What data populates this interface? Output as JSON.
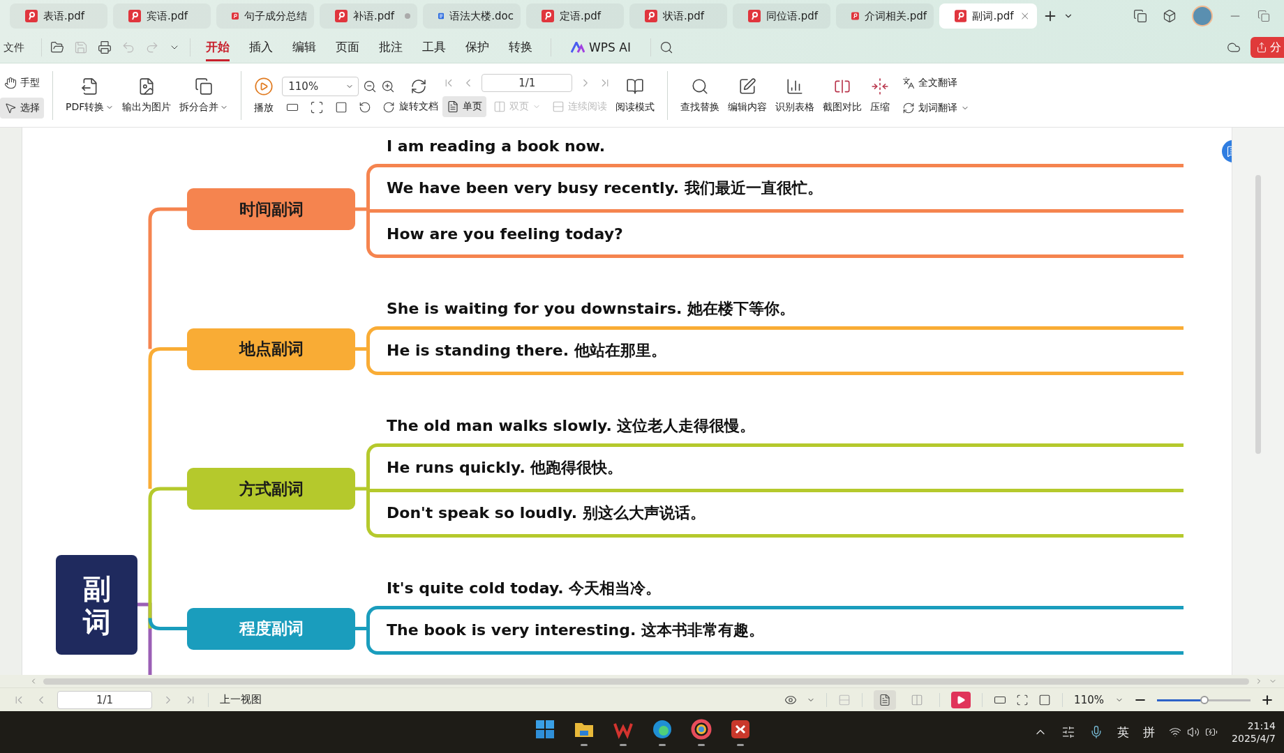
{
  "tabs": [
    {
      "label": "表语.pdf",
      "kind": "pdf",
      "selected": false,
      "modified": false
    },
    {
      "label": "宾语.pdf",
      "kind": "pdf",
      "selected": false,
      "modified": false
    },
    {
      "label": "句子成分总结",
      "kind": "pdf",
      "selected": false,
      "modified": false
    },
    {
      "label": "补语.pdf",
      "kind": "pdf",
      "selected": false,
      "modified": true
    },
    {
      "label": "语法大楼.doc",
      "kind": "word",
      "selected": false,
      "modified": false
    },
    {
      "label": "定语.pdf",
      "kind": "pdf",
      "selected": false,
      "modified": false
    },
    {
      "label": "状语.pdf",
      "kind": "pdf",
      "selected": false,
      "modified": false
    },
    {
      "label": "同位语.pdf",
      "kind": "pdf",
      "selected": false,
      "modified": false
    },
    {
      "label": "介词相关.pdf",
      "kind": "pdf",
      "selected": false,
      "modified": false
    },
    {
      "label": "副词.pdf",
      "kind": "pdf",
      "selected": true,
      "modified": false
    }
  ],
  "menu": {
    "file": "文件",
    "tabs": [
      {
        "label": "开始",
        "selected": true
      },
      {
        "label": "插入",
        "selected": false
      },
      {
        "label": "编辑",
        "selected": false
      },
      {
        "label": "页面",
        "selected": false
      },
      {
        "label": "批注",
        "selected": false
      },
      {
        "label": "工具",
        "selected": false
      },
      {
        "label": "保护",
        "selected": false
      },
      {
        "label": "转换",
        "selected": false
      }
    ],
    "ai": "WPS AI",
    "share": "分"
  },
  "toolbar": {
    "pointer_tools": [
      {
        "label": "手型",
        "kind": "hand",
        "selected": false
      },
      {
        "label": "选择",
        "kind": "select",
        "selected": true
      }
    ],
    "convert_tools": [
      {
        "label": "PDF转换",
        "kind": "convert",
        "dropdown": true
      },
      {
        "label": "输出为图片",
        "kind": "image",
        "dropdown": false
      },
      {
        "label": "拆分合并",
        "kind": "split",
        "dropdown": true
      }
    ],
    "play": "播放",
    "zoom": "110%",
    "rotate": "旋转文档",
    "page": "1/1",
    "view_modes": [
      {
        "label": "单页",
        "kind": "single",
        "selected": true,
        "disabled": false,
        "dropdown": false
      },
      {
        "label": "双页",
        "kind": "double",
        "selected": false,
        "disabled": true,
        "dropdown": true
      },
      {
        "label": "连续阅读",
        "kind": "continuous",
        "selected": false,
        "disabled": true,
        "dropdown": false
      }
    ],
    "read_mode": "阅读模式",
    "tools": [
      {
        "label": "查找替换",
        "kind": "find"
      },
      {
        "label": "编辑内容",
        "kind": "edit"
      },
      {
        "label": "识别表格",
        "kind": "table"
      },
      {
        "label": "截图对比",
        "kind": "compare"
      },
      {
        "label": "压缩",
        "kind": "compress"
      }
    ],
    "translate": [
      {
        "label": "全文翻译",
        "kind": "full",
        "dropdown": false
      },
      {
        "label": "划词翻译",
        "kind": "word",
        "dropdown": true
      }
    ]
  },
  "mindmap": {
    "root": "副词",
    "branches": [
      {
        "label": "时间副词",
        "color": "#f5844f",
        "sentences": [
          "I am reading a book now.",
          "We have been very busy recently. 我们最近一直很忙。",
          "How are you feeling today?"
        ]
      },
      {
        "label": "地点副词",
        "color": "#f9ac35",
        "sentences": [
          "She is waiting for you downstairs. 她在楼下等你。",
          "He is standing there. 他站在那里。"
        ]
      },
      {
        "label": "方式副词",
        "color": "#b5c92c",
        "sentences": [
          "The old man walks slowly. 这位老人走得很慢。",
          "He runs quickly. 他跑得很快。",
          "Don't speak so loudly. 别这么大声说话。"
        ]
      },
      {
        "label": "程度副词",
        "color": "#1a9dbd",
        "sentences": [
          "It's quite cold today. 今天相当冷。",
          "The book is very interesting. 这本书非常有趣。"
        ]
      }
    ]
  },
  "status_bar": {
    "page": "1/1",
    "back_view": "上一视图",
    "zoom": "110%",
    "zoom_slider": {
      "level": 0.51
    },
    "views": [
      {
        "kind": "single",
        "selected": true
      },
      {
        "kind": "double",
        "selected": false
      }
    ]
  },
  "taskbar": {
    "apps": [
      {
        "kind": "start",
        "running": false
      },
      {
        "kind": "folder",
        "running": true
      },
      {
        "kind": "wps",
        "running": true
      },
      {
        "kind": "edge",
        "running": true
      },
      {
        "kind": "ring",
        "running": true
      },
      {
        "kind": "red",
        "running": true
      }
    ],
    "input_lang": "英",
    "ime": "拼",
    "time": "21:14",
    "date": "2025/4/7"
  }
}
